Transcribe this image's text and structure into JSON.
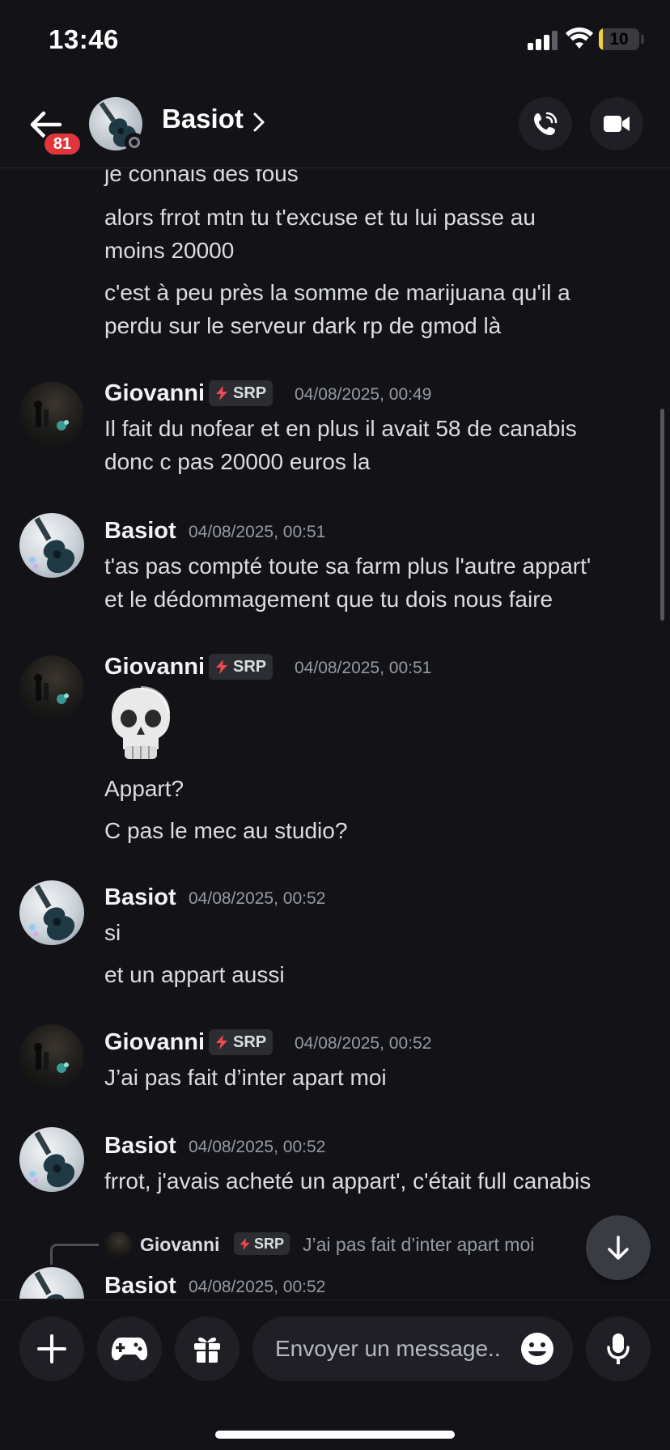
{
  "status_bar": {
    "time": "13:46",
    "battery": "10",
    "battery_level_percent": 10
  },
  "header": {
    "title": "Basiot",
    "unread_badge": "81",
    "icons": [
      "back-arrow-icon",
      "chevron-right-icon",
      "phone-call-icon",
      "video-camera-icon"
    ]
  },
  "messages": {
    "continuation": [
      "je connais des fous",
      "alors frrot mtn tu t'excuse et tu lui passe au",
      "moins 20000",
      "c'est à peu près la somme de marijuana qu'il a",
      "perdu sur le serveur dark rp de gmod là"
    ],
    "groups": [
      {
        "user": "Giovanni",
        "tag": "SRP",
        "time": "04/08/2025, 00:49",
        "lines": [
          "Il fait du nofear et en plus il avait 58 de canabis",
          "donc c pas 20000 euros la"
        ]
      },
      {
        "user": "Basiot",
        "time": "04/08/2025, 00:51",
        "lines": [
          "t'as pas compté toute sa farm plus l'autre appart'",
          "et  le dédommagement que tu dois nous faire"
        ]
      },
      {
        "user": "Giovanni",
        "tag": "SRP",
        "time": "04/08/2025, 00:51",
        "emoji": "skull-emoji",
        "lines": [
          "Appart?",
          "C pas le mec au studio?"
        ]
      },
      {
        "user": "Basiot",
        "time": "04/08/2025, 00:52",
        "lines": [
          "si",
          "et un appart aussi"
        ]
      },
      {
        "user": "Giovanni",
        "tag": "SRP",
        "time": "04/08/2025, 00:52",
        "lines": [
          "J’ai pas fait d’inter apart moi"
        ]
      },
      {
        "user": "Basiot",
        "time": "04/08/2025, 00:52",
        "lines": [
          "frrot, j'avais acheté un appart', c'était full canabis"
        ]
      },
      {
        "user": "Basiot",
        "time": "04/08/2025, 00:52",
        "reply": {
          "user": "Giovanni",
          "tag": "SRP",
          "text": "J’ai pas fait d’inter apart moi"
        }
      }
    ]
  },
  "composer": {
    "placeholder": "Envoyer un message…",
    "display_text": "Envoyer un message..",
    "icons": [
      "plus-icon",
      "gamepad-icon",
      "gift-icon",
      "emoji-icon",
      "microphone-icon"
    ]
  },
  "colors": {
    "background": "#121217",
    "badge": "#e0363b",
    "tag_bolt": "#f04a4f",
    "timestamp": "#949ba4"
  }
}
